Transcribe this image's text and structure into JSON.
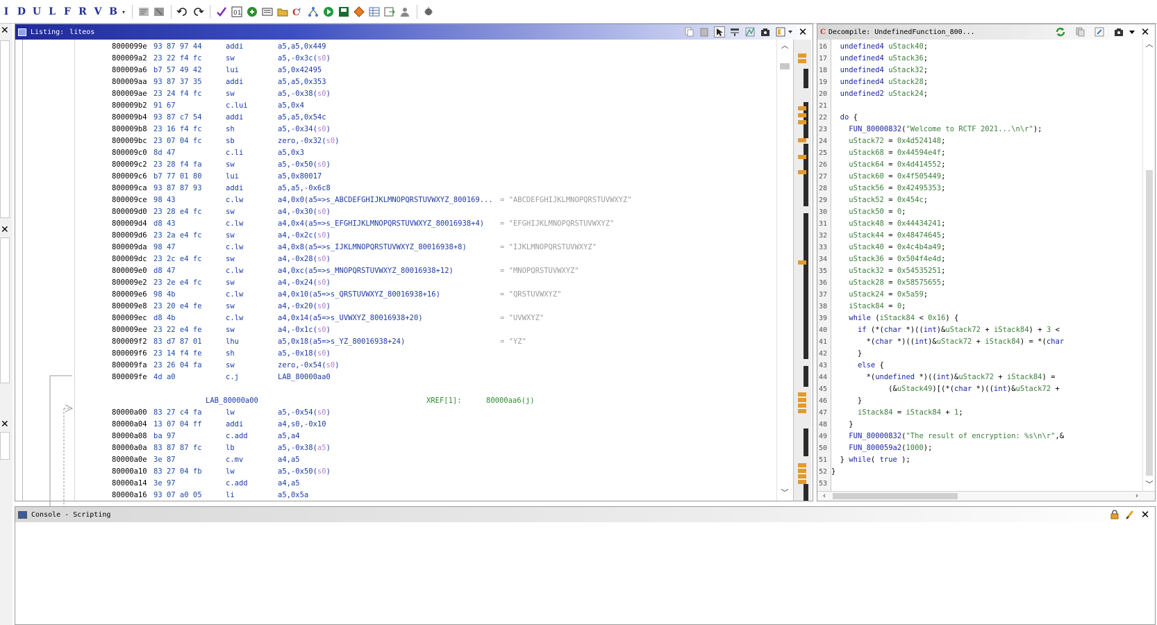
{
  "toolbar": {
    "letter_buttons": [
      "I",
      "D",
      "U",
      "L",
      "F",
      "R",
      "V",
      "B"
    ],
    "icons": [
      "clear-code-icon",
      "clear-flow-icon",
      "undo-icon",
      "redo-icon",
      "check-icon",
      "bytes-icon",
      "script-icon",
      "memory-icon",
      "folder-icon",
      "function-graph-icon",
      "tree-icon",
      "run-icon",
      "save-icon",
      "diamond-icon",
      "table-icon",
      "export-icon",
      "user-icon",
      "debug-icon"
    ]
  },
  "listing": {
    "title": "Listing:",
    "program": "liteos",
    "rows": [
      {
        "addr": "8000099e",
        "bytes": "93 87 97 44",
        "mnem": "addi",
        "ops": "a5,a5,0x449"
      },
      {
        "addr": "800009a2",
        "bytes": "23 22 f4 fc",
        "mnem": "sw",
        "ops": "a5,-0x3c(s0)"
      },
      {
        "addr": "800009a6",
        "bytes": "b7 57 49 42",
        "mnem": "lui",
        "ops": "a5,0x42495"
      },
      {
        "addr": "800009aa",
        "bytes": "93 87 37 35",
        "mnem": "addi",
        "ops": "a5,a5,0x353"
      },
      {
        "addr": "800009ae",
        "bytes": "23 24 f4 fc",
        "mnem": "sw",
        "ops": "a5,-0x38(s0)"
      },
      {
        "addr": "800009b2",
        "bytes": "91 67",
        "mnem": "c.lui",
        "ops": "a5,0x4"
      },
      {
        "addr": "800009b4",
        "bytes": "93 87 c7 54",
        "mnem": "addi",
        "ops": "a5,a5,0x54c"
      },
      {
        "addr": "800009b8",
        "bytes": "23 16 f4 fc",
        "mnem": "sh",
        "ops": "a5,-0x34(s0)"
      },
      {
        "addr": "800009bc",
        "bytes": "23 07 04 fc",
        "mnem": "sb",
        "ops": "zero,-0x32(s0)"
      },
      {
        "addr": "800009c0",
        "bytes": "8d 47",
        "mnem": "c.li",
        "ops": "a5,0x3"
      },
      {
        "addr": "800009c2",
        "bytes": "23 28 f4 fa",
        "mnem": "sw",
        "ops": "a5,-0x50(s0)"
      },
      {
        "addr": "800009c6",
        "bytes": "b7 77 01 80",
        "mnem": "lui",
        "ops": "a5,0x80017"
      },
      {
        "addr": "800009ca",
        "bytes": "93 87 87 93",
        "mnem": "addi",
        "ops": "a5,a5,-0x6c8"
      },
      {
        "addr": "800009ce",
        "bytes": "98 43",
        "mnem": "c.lw",
        "ops": "a4,0x0(a5=>s_ABCDEFGHIJKLMNOPQRSTUVWXYZ_800169...",
        "eq": "= \"ABCDEFGHIJKLMNOPQRSTUVWXYZ\""
      },
      {
        "addr": "800009d0",
        "bytes": "23 28 e4 fc",
        "mnem": "sw",
        "ops": "a4,-0x30(s0)"
      },
      {
        "addr": "800009d4",
        "bytes": "d8 43",
        "mnem": "c.lw",
        "ops": "a4,0x4(a5=>s_EFGHIJKLMNOPQRSTUVWXYZ_80016938+4)",
        "eq": "= \"EFGHIJKLMNOPQRSTUVWXYZ\""
      },
      {
        "addr": "800009d6",
        "bytes": "23 2a e4 fc",
        "mnem": "sw",
        "ops": "a4,-0x2c(s0)"
      },
      {
        "addr": "800009da",
        "bytes": "98 47",
        "mnem": "c.lw",
        "ops": "a4,0x8(a5=>s_IJKLMNOPQRSTUVWXYZ_80016938+8)",
        "eq": "= \"IJKLMNOPQRSTUVWXYZ\""
      },
      {
        "addr": "800009dc",
        "bytes": "23 2c e4 fc",
        "mnem": "sw",
        "ops": "a4,-0x28(s0)"
      },
      {
        "addr": "800009e0",
        "bytes": "d8 47",
        "mnem": "c.lw",
        "ops": "a4,0xc(a5=>s_MNOPQRSTUVWXYZ_80016938+12)",
        "eq": "= \"MNOPQRSTUVWXYZ\""
      },
      {
        "addr": "800009e2",
        "bytes": "23 2e e4 fc",
        "mnem": "sw",
        "ops": "a4,-0x24(s0)"
      },
      {
        "addr": "800009e6",
        "bytes": "98 4b",
        "mnem": "c.lw",
        "ops": "a4,0x10(a5=>s_QRSTUVWXYZ_80016938+16)",
        "eq": "= \"QRSTUVWXYZ\""
      },
      {
        "addr": "800009e8",
        "bytes": "23 20 e4 fe",
        "mnem": "sw",
        "ops": "a4,-0x20(s0)"
      },
      {
        "addr": "800009ec",
        "bytes": "d8 4b",
        "mnem": "c.lw",
        "ops": "a4,0x14(a5=>s_UVWXYZ_80016938+20)",
        "eq": "= \"UVWXYZ\""
      },
      {
        "addr": "800009ee",
        "bytes": "23 22 e4 fe",
        "mnem": "sw",
        "ops": "a4,-0x1c(s0)"
      },
      {
        "addr": "800009f2",
        "bytes": "83 d7 87 01",
        "mnem": "lhu",
        "ops": "a5,0x18(a5=>s_YZ_80016938+24)",
        "eq": "= \"YZ\""
      },
      {
        "addr": "800009f6",
        "bytes": "23 14 f4 fe",
        "mnem": "sh",
        "ops": "a5,-0x18(s0)"
      },
      {
        "addr": "800009fa",
        "bytes": "23 26 04 fa",
        "mnem": "sw",
        "ops": "zero,-0x54(s0)"
      },
      {
        "addr": "800009fe",
        "bytes": "4d a0",
        "mnem": "c.j",
        "ops": "LAB_80000aa0"
      }
    ],
    "label": {
      "name": "LAB_80000a00",
      "xref": "XREF[1]:",
      "xref_addr": "80000aa6(j)"
    },
    "rows2": [
      {
        "addr": "80000a00",
        "bytes": "83 27 c4 fa",
        "mnem": "lw",
        "ops": "a5,-0x54(s0)"
      },
      {
        "addr": "80000a04",
        "bytes": "13 07 04 ff",
        "mnem": "addi",
        "ops": "a4,s0,-0x10"
      },
      {
        "addr": "80000a08",
        "bytes": "ba 97",
        "mnem": "c.add",
        "ops": "a5,a4"
      },
      {
        "addr": "80000a0a",
        "bytes": "83 87 87 fc",
        "mnem": "lb",
        "ops": "a5,-0x38(a5)"
      },
      {
        "addr": "80000a0e",
        "bytes": "3e 87",
        "mnem": "c.mv",
        "ops": "a4,a5"
      },
      {
        "addr": "80000a10",
        "bytes": "83 27 04 fb",
        "mnem": "lw",
        "ops": "a5,-0x50(s0)"
      },
      {
        "addr": "80000a14",
        "bytes": "3e 97",
        "mnem": "c.add",
        "ops": "a4,a5"
      },
      {
        "addr": "80000a16",
        "bytes": "93 07 a0 05",
        "mnem": "li",
        "ops": "a5,0x5a"
      }
    ]
  },
  "decompile": {
    "title": "Decompile: UndefinedFunction_800...",
    "line_numbers": [
      "16",
      "17",
      "18",
      "19",
      "20",
      "21",
      "22",
      "23",
      "24",
      "25",
      "26",
      "27",
      "28",
      "29",
      "30",
      "31",
      "32",
      "33",
      "34",
      "35",
      "36",
      "37",
      "38",
      "39",
      "40",
      "41",
      "42",
      "43",
      "44",
      "45",
      "46",
      "47",
      "48",
      "49",
      "50",
      "51",
      "52",
      "53"
    ],
    "lines": [
      "  undefined4 uStack40;",
      "  undefined4 uStack36;",
      "  undefined4 uStack32;",
      "  undefined4 uStack28;",
      "  undefined2 uStack24;",
      "",
      "  do {",
      "    FUN_80000832(\"Welcome to RCTF 2021...\\n\\r\");",
      "    uStack72 = 0x4d524148;",
      "    uStack68 = 0x44594e4f;",
      "    uStack64 = 0x4d414552;",
      "    uStack60 = 0x4f505449;",
      "    uStack56 = 0x42495353;",
      "    uStack52 = 0x454c;",
      "    uStack50 = 0;",
      "    uStack48 = 0x44434241;",
      "    uStack44 = 0x48474645;",
      "    uStack40 = 0x4c4b4a49;",
      "    uStack36 = 0x504f4e4d;",
      "    uStack32 = 0x54535251;",
      "    uStack28 = 0x58575655;",
      "    uStack24 = 0x5a59;",
      "    iStack84 = 0;",
      "    while (iStack84 < 0x16) {",
      "      if (*(char *)((int)&uStack72 + iStack84) + 3 < ",
      "        *(char *)((int)&uStack72 + iStack84) = *(char",
      "      }",
      "      else {",
      "        *(undefined *)((int)&uStack72 + iStack84) =",
      "             (&uStack49)[(*(char *)((int)&uStack72 +",
      "      }",
      "      iStack84 = iStack84 + 1;",
      "    }",
      "    FUN_80000832(\"The result of encryption: %s\\n\\r\",&",
      "    FUN_800059a2(1000);",
      "  } while( true );",
      "}",
      ""
    ]
  },
  "console": {
    "title": "Console - Scripting"
  },
  "colors": {
    "active_title": "#1f2a9a",
    "address": "#000000",
    "bytes": "#1c4aa6",
    "mnemonic": "#1c3aa8",
    "register": "#b57fc9",
    "string_equate": "#9a9a9a",
    "xref": "#2e8b2e",
    "decomp_keyword": "#1b23a8",
    "decomp_variable": "#3b7f3b"
  }
}
